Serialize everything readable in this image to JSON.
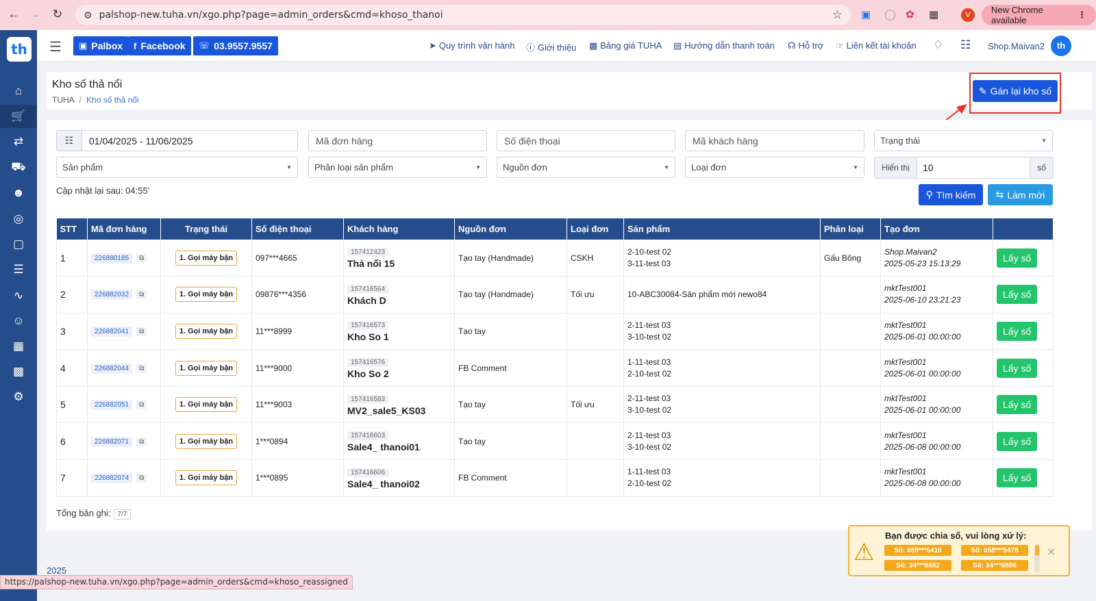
{
  "browser": {
    "url": "palshop-new.tuha.vn/xgo.php?page=admin_orders&cmd=khoso_thanoi",
    "new_chrome": "New Chrome available",
    "profile_initial": "V",
    "status_url": "https://palshop-new.tuha.vn/xgo.php?page=admin_orders&cmd=khoso_reassigned"
  },
  "sidebar": {
    "logo": "th"
  },
  "topbar": {
    "palbox": "Palbox",
    "facebook": "Facebook",
    "phone": "03.9557.9557",
    "links": {
      "quy_trinh": "Quy trình vận hành",
      "gioi_thieu": "Giới thiệu",
      "bang_gia": "Bảng giá TUHA",
      "huong_dan": "Hướng dẫn thanh toán",
      "ho_tro": "Hỗ trợ",
      "lien_ket": "Liên kết tài khoản"
    },
    "user": "Shop.Maivan2",
    "user_avatar": "th"
  },
  "page": {
    "title": "Kho số thả nổi",
    "breadcrumb_root": "TUHA",
    "breadcrumb_current": "Kho số thả nổi",
    "reassign_button": "Gán lại kho số"
  },
  "filters": {
    "date_range": "01/04/2025 - 11/06/2025",
    "order_code_placeholder": "Mã đơn hàng",
    "phone_placeholder": "Số điện thoại",
    "customer_code_placeholder": "Mã khách hàng",
    "status": "Trạng thái",
    "product": "Sản phẩm",
    "product_type": "Phân loại sản phẩm",
    "source": "Nguồn đơn",
    "order_type": "Loại đơn",
    "show_label": "Hiển thị",
    "show_value": "10",
    "show_unit": "số",
    "update_text": "Cập nhật lại sau: 04:55'",
    "search_button": "Tìm kiếm",
    "reset_button": "Làm mới"
  },
  "table": {
    "headers": [
      "STT",
      "Mã đơn hàng",
      "Trạng thái",
      "Số điện thoại",
      "Khách hàng",
      "Nguồn đơn",
      "Loại đơn",
      "Sản phẩm",
      "Phân loại",
      "Tạo đơn",
      ""
    ],
    "rows": [
      {
        "stt": "1",
        "order": "226880185",
        "status": "1. Gọi máy bận",
        "phone": "097***4665",
        "cust_id": "157412423",
        "cust_name": "Thả nổi 15",
        "source": "Tạo tay (Handmade)",
        "type": "CSKH",
        "product1": "2-10-test 02",
        "product2": "3-11-test 03",
        "category": "Gấu Bông",
        "creator": "Shop.Maivan2",
        "created": "2025-05-23 15:13:29",
        "action": "Lấy số"
      },
      {
        "stt": "2",
        "order": "226882032",
        "status": "1. Gọi máy bận",
        "phone": "09876***4356",
        "cust_id": "157416564",
        "cust_name": "Khách D",
        "source": "Tạo tay (Handmade)",
        "type": "Tối ưu",
        "product1": "10-ABC30084-Sản phẩm mới newo84",
        "product2": "",
        "category": "",
        "creator": "mktTest001",
        "created": "2025-06-10 23:21:23",
        "action": "Lấy số"
      },
      {
        "stt": "3",
        "order": "226882041",
        "status": "1. Gọi máy bận",
        "phone": "11***8999",
        "cust_id": "157416573",
        "cust_name": "Kho So 1",
        "source": "Tạo tay",
        "type": "",
        "product1": "2-11-test 03",
        "product2": "3-10-test 02",
        "category": "",
        "creator": "mktTest001",
        "created": "2025-06-01 00:00:00",
        "action": "Lấy số"
      },
      {
        "stt": "4",
        "order": "226882044",
        "status": "1. Gọi máy bận",
        "phone": "11***9000",
        "cust_id": "157416576",
        "cust_name": "Kho So 2",
        "source": "FB Comment",
        "type": "",
        "product1": "1-11-test 03",
        "product2": "2-10-test 02",
        "category": "",
        "creator": "mktTest001",
        "created": "2025-06-01 00:00:00",
        "action": "Lấy số"
      },
      {
        "stt": "5",
        "order": "226882051",
        "status": "1. Gọi máy bận",
        "phone": "11***9003",
        "cust_id": "157416583",
        "cust_name": "MV2_sale5_KS03",
        "source": "Tạo tay",
        "type": "Tối ưu",
        "product1": "2-11-test 03",
        "product2": "3-10-test 02",
        "category": "",
        "creator": "mktTest001",
        "created": "2025-06-01 00:00:00",
        "action": "Lấy số"
      },
      {
        "stt": "6",
        "order": "226882071",
        "status": "1. Gọi máy bận",
        "phone": "1***0894",
        "cust_id": "157416603",
        "cust_name": "Sale4_ thanoi01",
        "source": "Tạo tay",
        "type": "",
        "product1": "2-11-test 03",
        "product2": "3-10-test 02",
        "category": "",
        "creator": "mktTest001",
        "created": "2025-06-08 00:00:00",
        "action": "Lấy số"
      },
      {
        "stt": "7",
        "order": "226882074",
        "status": "1. Gọi máy bận",
        "phone": "1***0895",
        "cust_id": "157416606",
        "cust_name": "Sale4_ thanoi02",
        "source": "FB Comment",
        "type": "",
        "product1": "1-11-test 03",
        "product2": "2-10-test 02",
        "category": "",
        "creator": "mktTest001",
        "created": "2025-06-08 00:00:00",
        "action": "Lấy số"
      }
    ],
    "total_label": "Tổng bản ghi:",
    "total_value": "7/7"
  },
  "footer": {
    "year": "2025"
  },
  "notification": {
    "title": "Bạn được chia số, vui lòng xử lý:",
    "numbers": [
      "Số: 059***5410",
      "Số: 058***5478",
      "Số: 34***8882",
      "Số: 34***8886"
    ]
  },
  "colors": {
    "primary": "#1a56db",
    "sidebar": "#264d8b",
    "success": "#23c46b",
    "warning": "#f3a81d",
    "highlight": "#e53030"
  }
}
